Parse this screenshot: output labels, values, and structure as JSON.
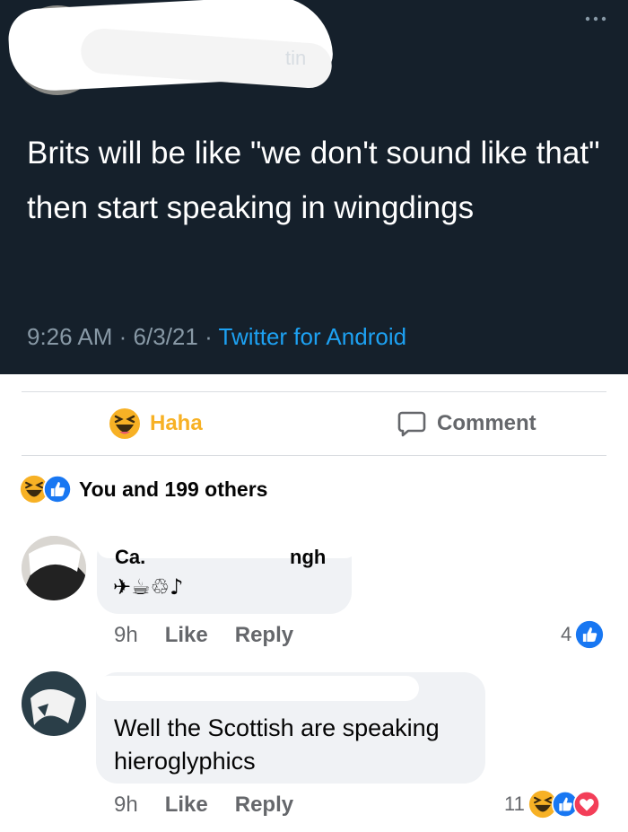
{
  "tweet": {
    "author_partial": "tin",
    "text": "Brits will be like \"we don't sound like that\" then start speaking in wingdings",
    "time": "9:26 AM",
    "separator": "·",
    "date": "6/3/21",
    "app": "Twitter for Android"
  },
  "post_actions": {
    "haha_label": "Haha",
    "comment_label": "Comment"
  },
  "reactions_summary": {
    "text": "You and 199 others"
  },
  "comments": [
    {
      "author_partial": "Ca.",
      "text_partial": "ngh",
      "wingdings_text": "✈☕♲♪",
      "time": "9h",
      "like_label": "Like",
      "reply_label": "Reply",
      "reaction_count": "4"
    },
    {
      "text": "Well the Scottish are speaking hieroglyphics",
      "time": "9h",
      "like_label": "Like",
      "reply_label": "Reply",
      "reaction_count": "11"
    }
  ],
  "colors": {
    "tweet_bg": "#15202b",
    "twitter_blue": "#1da1f2",
    "haha_yellow": "#f7b125",
    "fb_blue": "#1877f2",
    "love_red": "#f33e58",
    "bubble_bg": "#f0f2f5"
  }
}
